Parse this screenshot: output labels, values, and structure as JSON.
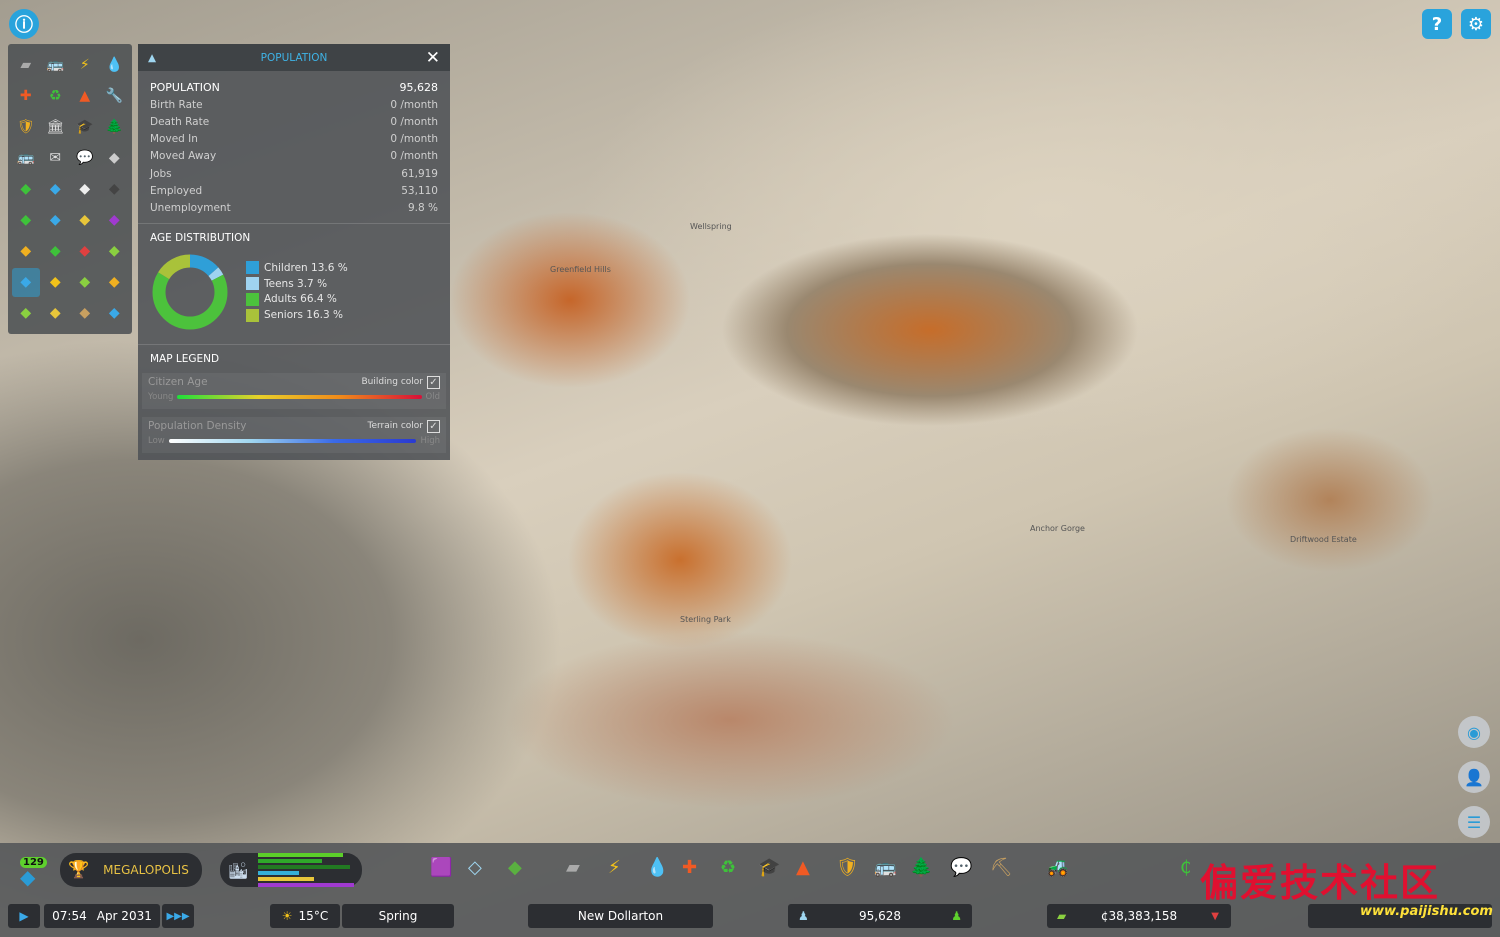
{
  "top": {
    "info_icon": "info-icon",
    "help_icon": "help-icon",
    "settings_icon": "gear-icon"
  },
  "toolbar": {
    "icons": [
      "road",
      "transport",
      "electricity",
      "water",
      "healthcare",
      "garbage",
      "fire",
      "services",
      "police",
      "administration",
      "education",
      "parks",
      "bus",
      "mail",
      "communication",
      "unknown",
      "trees",
      "area",
      "bulldoze",
      "unknown2",
      "zoning-green",
      "zoning-blue",
      "zoning-yellow",
      "zoning-purple",
      "residential",
      "commercial",
      "trend",
      "agriculture",
      "population",
      "happiness",
      "cash",
      "building",
      "landscaping",
      "fields",
      "mining",
      "water-area"
    ]
  },
  "panel": {
    "title": "POPULATION",
    "stats": [
      {
        "label": "POPULATION",
        "value": "95,628"
      },
      {
        "label": "Birth Rate",
        "value": "0 /month"
      },
      {
        "label": "Death Rate",
        "value": "0 /month"
      },
      {
        "label": "Moved In",
        "value": "0 /month"
      },
      {
        "label": "Moved Away",
        "value": "0 /month"
      },
      {
        "label": "Jobs",
        "value": "61,919"
      },
      {
        "label": "Employed",
        "value": "53,110"
      },
      {
        "label": "Unemployment",
        "value": "9.8 %"
      }
    ],
    "age_title": "AGE DISTRIBUTION",
    "age": [
      {
        "label": "Children",
        "pct": "13.6 %",
        "value": 13.6,
        "color": "#2f9fd8"
      },
      {
        "label": "Teens",
        "pct": "3.7 %",
        "value": 3.7,
        "color": "#9fd3f0"
      },
      {
        "label": "Adults",
        "pct": "66.4 %",
        "value": 66.4,
        "color": "#4cc23c"
      },
      {
        "label": "Seniors",
        "pct": "16.3 %",
        "value": 16.3,
        "color": "#a9c23a"
      }
    ],
    "legend_title": "MAP LEGEND",
    "legend": [
      {
        "name": "Citizen Age",
        "toggle": "Building color",
        "low": "Young",
        "high": "Old",
        "checked": true
      },
      {
        "name": "Population Density",
        "toggle": "Terrain color",
        "low": "Low",
        "high": "High",
        "checked": true
      }
    ]
  },
  "map_labels": [
    "Wellspring",
    "Greenfield Hills",
    "Sterling Park",
    "Anchor Gorge",
    "Driftwood Estate"
  ],
  "bottom": {
    "level": "129",
    "milestone": "MEGALOPOLIS",
    "time": "07:54",
    "date": "Apr 2031",
    "temperature": "15°C",
    "season": "Spring",
    "city": "New Dollarton",
    "population": "95,628",
    "money": "¢38,383,158"
  },
  "watermark": {
    "text": "偏爱技术社区",
    "url": "www.paijishu.com"
  }
}
